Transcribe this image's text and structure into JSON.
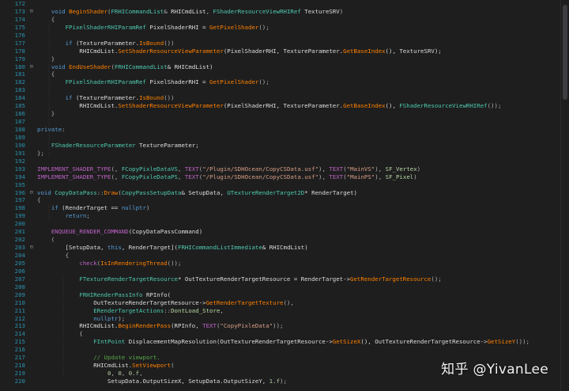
{
  "editor": {
    "lines": [
      {
        "n": "172",
        "fold": "",
        "tokens": []
      },
      {
        "n": "173",
        "fold": "⊟",
        "tokens": [
          [
            "    ",
            "t-var"
          ],
          [
            "void",
            "t-kw"
          ],
          [
            " ",
            "t-var"
          ],
          [
            "BeginShader",
            "t-fn"
          ],
          [
            "(",
            "t-p"
          ],
          [
            "FRHICommandList",
            "t-type"
          ],
          [
            "& ",
            "t-p"
          ],
          [
            "RHICmdList",
            "t-var"
          ],
          [
            ", ",
            "t-p"
          ],
          [
            "FShaderResourceViewRHIRef",
            "t-type"
          ],
          [
            " TextureSRV",
            "t-var"
          ],
          [
            ")",
            "t-p"
          ]
        ]
      },
      {
        "n": "174",
        "fold": "",
        "tokens": [
          [
            "    {",
            "t-p"
          ]
        ]
      },
      {
        "n": "175",
        "fold": "",
        "tokens": [
          [
            "        ",
            "t-var"
          ],
          [
            "FPixelShaderRHIParamRef",
            "t-type"
          ],
          [
            " PixelShaderRHI = ",
            "t-var"
          ],
          [
            "GetPixelShader",
            "t-fn"
          ],
          [
            "();",
            "t-p"
          ]
        ]
      },
      {
        "n": "176",
        "fold": "",
        "tokens": []
      },
      {
        "n": "177",
        "fold": "",
        "tokens": [
          [
            "        ",
            "t-var"
          ],
          [
            "if",
            "t-kw"
          ],
          [
            " (TextureParameter.",
            "t-var"
          ],
          [
            "IsBound",
            "t-fn"
          ],
          [
            "())",
            "t-p"
          ]
        ]
      },
      {
        "n": "178",
        "fold": "",
        "tokens": [
          [
            "            RHICmdList.",
            "t-var"
          ],
          [
            "SetShaderResourceViewParameter",
            "t-fn"
          ],
          [
            "(PixelShaderRHI, TextureParameter.",
            "t-var"
          ],
          [
            "GetBaseIndex",
            "t-fn"
          ],
          [
            "(), TextureSRV);",
            "t-var"
          ]
        ]
      },
      {
        "n": "179",
        "fold": "",
        "tokens": [
          [
            "    }",
            "t-p"
          ]
        ]
      },
      {
        "n": "180",
        "fold": "⊟",
        "tokens": [
          [
            "    ",
            "t-var"
          ],
          [
            "void",
            "t-kw"
          ],
          [
            " ",
            "t-var"
          ],
          [
            "EndUseShader",
            "t-fn"
          ],
          [
            "(",
            "t-p"
          ],
          [
            "FRHICommandList",
            "t-type"
          ],
          [
            "& RHICmdList)",
            "t-var"
          ]
        ]
      },
      {
        "n": "181",
        "fold": "",
        "tokens": [
          [
            "    {",
            "t-p"
          ]
        ]
      },
      {
        "n": "182",
        "fold": "",
        "tokens": [
          [
            "        ",
            "t-var"
          ],
          [
            "FPixelShaderRHIParamRef",
            "t-type"
          ],
          [
            " PixelShaderRHI = ",
            "t-var"
          ],
          [
            "GetPixelShader",
            "t-fn"
          ],
          [
            "();",
            "t-p"
          ]
        ]
      },
      {
        "n": "183",
        "fold": "",
        "tokens": []
      },
      {
        "n": "184",
        "fold": "",
        "tokens": [
          [
            "        ",
            "t-var"
          ],
          [
            "if",
            "t-kw"
          ],
          [
            " (TextureParameter.",
            "t-var"
          ],
          [
            "IsBound",
            "t-fn"
          ],
          [
            "())",
            "t-p"
          ]
        ]
      },
      {
        "n": "185",
        "fold": "",
        "tokens": [
          [
            "            RHICmdList.",
            "t-var"
          ],
          [
            "SetShaderResourceViewParameter",
            "t-fn"
          ],
          [
            "(PixelShaderRHI, TextureParameter.",
            "t-var"
          ],
          [
            "GetBaseIndex",
            "t-fn"
          ],
          [
            "(), ",
            "t-var"
          ],
          [
            "FShaderResourceViewRHIRef",
            "t-type"
          ],
          [
            "());",
            "t-p"
          ]
        ]
      },
      {
        "n": "186",
        "fold": "",
        "tokens": [
          [
            "    }",
            "t-p"
          ]
        ]
      },
      {
        "n": "187",
        "fold": "",
        "tokens": []
      },
      {
        "n": "188",
        "fold": "",
        "tokens": [
          [
            "private",
            "t-kw"
          ],
          [
            ":",
            "t-p"
          ]
        ]
      },
      {
        "n": "189",
        "fold": "",
        "tokens": []
      },
      {
        "n": "190",
        "fold": "",
        "tokens": [
          [
            "    ",
            "t-var"
          ],
          [
            "FShaderResourceParameter",
            "t-type"
          ],
          [
            " TextureParameter;",
            "t-var"
          ]
        ]
      },
      {
        "n": "191",
        "fold": "",
        "tokens": [
          [
            "};",
            "t-p"
          ]
        ]
      },
      {
        "n": "192",
        "fold": "",
        "tokens": []
      },
      {
        "n": "193",
        "fold": "",
        "tokens": [
          [
            "IMPLEMENT_SHADER_TYPE",
            "t-macro"
          ],
          [
            "(, ",
            "t-p"
          ],
          [
            "FCopyPixleDataVS",
            "t-type"
          ],
          [
            ", ",
            "t-p"
          ],
          [
            "TEXT",
            "t-macro"
          ],
          [
            "(",
            "t-p"
          ],
          [
            "\"/Plugin/SDHOcean/CopyCSData.usf\"",
            "t-str"
          ],
          [
            "), ",
            "t-p"
          ],
          [
            "TEXT",
            "t-macro"
          ],
          [
            "(",
            "t-p"
          ],
          [
            "\"MainVS\"",
            "t-str"
          ],
          [
            "), ",
            "t-p"
          ],
          [
            "SF_Vertex",
            "t-enum"
          ],
          [
            ")",
            "t-p"
          ]
        ]
      },
      {
        "n": "194",
        "fold": "",
        "tokens": [
          [
            "IMPLEMENT_SHADER_TYPE",
            "t-macro"
          ],
          [
            "(, ",
            "t-p"
          ],
          [
            "FCopyPixleDataPS",
            "t-type"
          ],
          [
            ", ",
            "t-p"
          ],
          [
            "TEXT",
            "t-macro"
          ],
          [
            "(",
            "t-p"
          ],
          [
            "\"/Plugin/SDHOcean/CopyCSData.usf\"",
            "t-str"
          ],
          [
            "), ",
            "t-p"
          ],
          [
            "TEXT",
            "t-macro"
          ],
          [
            "(",
            "t-p"
          ],
          [
            "\"MainPS\"",
            "t-str"
          ],
          [
            "), ",
            "t-p"
          ],
          [
            "SF_Pixel",
            "t-enum"
          ],
          [
            ")",
            "t-p"
          ]
        ]
      },
      {
        "n": "195",
        "fold": "",
        "tokens": []
      },
      {
        "n": "196",
        "fold": "⊟",
        "tokens": [
          [
            "void",
            "t-kw"
          ],
          [
            " ",
            "t-var"
          ],
          [
            "CopyDataPass",
            "t-type"
          ],
          [
            "::",
            "t-p"
          ],
          [
            "Draw",
            "t-fn"
          ],
          [
            "(",
            "t-p"
          ],
          [
            "CopyPassSetupData",
            "t-type"
          ],
          [
            "& SetupData, ",
            "t-var"
          ],
          [
            "UTextureRenderTarget2D",
            "t-type"
          ],
          [
            "* RenderTarget)",
            "t-var"
          ]
        ]
      },
      {
        "n": "197",
        "fold": "",
        "tokens": [
          [
            "{",
            "t-p"
          ]
        ]
      },
      {
        "n": "198",
        "fold": "",
        "tokens": [
          [
            "    ",
            "t-var"
          ],
          [
            "if",
            "t-kw"
          ],
          [
            " (RenderTarget == ",
            "t-var"
          ],
          [
            "nullptr",
            "t-kw"
          ],
          [
            ")",
            "t-p"
          ]
        ]
      },
      {
        "n": "199",
        "fold": "",
        "tokens": [
          [
            "        ",
            "t-var"
          ],
          [
            "return",
            "t-kw"
          ],
          [
            ";",
            "t-p"
          ]
        ]
      },
      {
        "n": "200",
        "fold": "",
        "tokens": []
      },
      {
        "n": "201",
        "fold": "",
        "tokens": [
          [
            "    ",
            "t-var"
          ],
          [
            "ENQUEUE_RENDER_COMMAND",
            "t-macro"
          ],
          [
            "(CopyDataPassCommand)",
            "t-var"
          ]
        ]
      },
      {
        "n": "202",
        "fold": "",
        "tokens": [
          [
            "    (",
            "t-p"
          ]
        ]
      },
      {
        "n": "203",
        "fold": "⊟",
        "tokens": [
          [
            "        [SetupData, ",
            "t-var"
          ],
          [
            "this",
            "t-kw"
          ],
          [
            ", RenderTarget](",
            "t-var"
          ],
          [
            "FRHICommandListImmediate",
            "t-type"
          ],
          [
            "& RHICmdList)",
            "t-var"
          ]
        ]
      },
      {
        "n": "204",
        "fold": "",
        "tokens": [
          [
            "        {",
            "t-p"
          ]
        ]
      },
      {
        "n": "205",
        "fold": "",
        "tokens": [
          [
            "            ",
            "t-var"
          ],
          [
            "check",
            "t-macro"
          ],
          [
            "(",
            "t-p"
          ],
          [
            "IsInRenderingThread",
            "t-fn"
          ],
          [
            "());",
            "t-p"
          ]
        ]
      },
      {
        "n": "206",
        "fold": "",
        "tokens": []
      },
      {
        "n": "207",
        "fold": "",
        "tokens": [
          [
            "            ",
            "t-var"
          ],
          [
            "FTextureRenderTargetResource",
            "t-type"
          ],
          [
            "* OutTextureRenderTargetResource = RenderTarget->",
            "t-var"
          ],
          [
            "GetRenderTargetResource",
            "t-fn"
          ],
          [
            "();",
            "t-p"
          ]
        ]
      },
      {
        "n": "208",
        "fold": "",
        "tokens": []
      },
      {
        "n": "209",
        "fold": "",
        "tokens": [
          [
            "            ",
            "t-var"
          ],
          [
            "FRHIRenderPassInfo",
            "t-type"
          ],
          [
            " RPInfo(",
            "t-var"
          ]
        ]
      },
      {
        "n": "210",
        "fold": "",
        "tokens": [
          [
            "                OutTextureRenderTargetResource->",
            "t-var"
          ],
          [
            "GetRenderTargetTexture",
            "t-fn"
          ],
          [
            "(),",
            "t-p"
          ]
        ]
      },
      {
        "n": "211",
        "fold": "",
        "tokens": [
          [
            "                ",
            "t-var"
          ],
          [
            "ERenderTargetActions",
            "t-type"
          ],
          [
            "::",
            "t-p"
          ],
          [
            "DontLoad_Store",
            "t-enum"
          ],
          [
            ",",
            "t-p"
          ]
        ]
      },
      {
        "n": "212",
        "fold": "",
        "tokens": [
          [
            "                ",
            "t-var"
          ],
          [
            "nullptr",
            "t-kw"
          ],
          [
            ");",
            "t-p"
          ]
        ]
      },
      {
        "n": "213",
        "fold": "",
        "tokens": [
          [
            "            RHICmdList.",
            "t-var"
          ],
          [
            "BeginRenderPass",
            "t-fn"
          ],
          [
            "(RPInfo, ",
            "t-var"
          ],
          [
            "TEXT",
            "t-macro"
          ],
          [
            "(",
            "t-p"
          ],
          [
            "\"CopyPixleData\"",
            "t-str"
          ],
          [
            "));",
            "t-p"
          ]
        ]
      },
      {
        "n": "214",
        "fold": "",
        "tokens": [
          [
            "            {",
            "t-p"
          ]
        ]
      },
      {
        "n": "215",
        "fold": "",
        "tokens": [
          [
            "                ",
            "t-var"
          ],
          [
            "FIntPoint",
            "t-type"
          ],
          [
            " DisplacementMapResolution(OutTextureRenderTargetResource->",
            "t-var"
          ],
          [
            "GetSizeX",
            "t-fn"
          ],
          [
            "(), OutTextureRenderTargetResource->",
            "t-var"
          ],
          [
            "GetSizeY",
            "t-fn"
          ],
          [
            "());",
            "t-p"
          ]
        ]
      },
      {
        "n": "216",
        "fold": "",
        "tokens": []
      },
      {
        "n": "217",
        "fold": "",
        "tokens": [
          [
            "                ",
            "t-var"
          ],
          [
            "// Update viewport.",
            "t-cm"
          ]
        ]
      },
      {
        "n": "218",
        "fold": "",
        "tokens": [
          [
            "                RHICmdList.",
            "t-var"
          ],
          [
            "SetViewport",
            "t-fn"
          ],
          [
            "(",
            "t-p"
          ]
        ]
      },
      {
        "n": "219",
        "fold": "",
        "tokens": [
          [
            "                    ",
            "t-var"
          ],
          [
            "0",
            "t-num"
          ],
          [
            ", ",
            "t-p"
          ],
          [
            "0",
            "t-num"
          ],
          [
            ", ",
            "t-p"
          ],
          [
            "0.f",
            "t-num"
          ],
          [
            ",",
            "t-p"
          ]
        ]
      },
      {
        "n": "220",
        "fold": "",
        "tokens": [
          [
            "                    SetupData.OutputSizeX, SetupData.OutputSizeY, ",
            "t-var"
          ],
          [
            "1.f",
            "t-num"
          ],
          [
            ");",
            "t-p"
          ]
        ]
      }
    ]
  },
  "watermark": {
    "text": "知乎 @YivanLee"
  }
}
